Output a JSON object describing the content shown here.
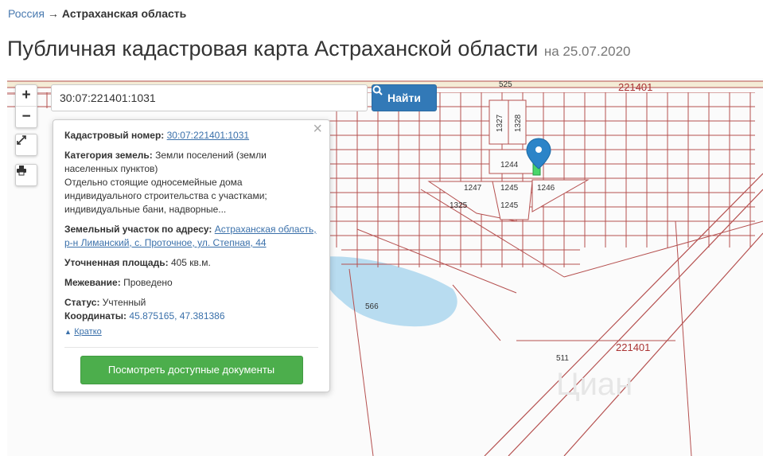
{
  "breadcrumbs": {
    "root": "Россия",
    "separator": "→",
    "current": "Астраханская область"
  },
  "page": {
    "title": "Публичная кадастровая карта Астраханской области",
    "date": "на 25.07.2020"
  },
  "search": {
    "value": "30:07:221401:1031",
    "button_label": "Найти"
  },
  "zoom": {
    "in": "+",
    "out": "−"
  },
  "popup": {
    "cad_label": "Кадастровый номер:",
    "cad_value": "30:07:221401:1031",
    "category_label": "Категория земель:",
    "category_value": "Земли поселений (земли населенных пунктов)",
    "usage_text": "Отдельно стоящие односемейные дома индивидуального строительства с участками; индивидуальные бани, надворные...",
    "address_label": "Земельный участок по адресу:",
    "address_value": "Астраханская область, р-н Лиманский, с. Проточное, ул. Степная, 44",
    "area_label": "Уточненная площадь:",
    "area_value": "405 кв.м.",
    "survey_label": "Межевание:",
    "survey_value": "Проведено",
    "status_label": "Статус:",
    "status_value": "Учтенный",
    "coords_label": "Координаты:",
    "coords_value": "45.875165, 47.381386",
    "short_label": "Кратко",
    "docs_button": "Посмотреть доступные документы"
  },
  "map_labels": {
    "road": "525",
    "quarter_top": "221401",
    "quarter_bottom": "221401",
    "p1327": "1327",
    "p1328": "1328",
    "p1244": "1244",
    "p1247": "1247",
    "p1245a": "1245",
    "p1246": "1246",
    "p1325": "1325",
    "p1245b": "1245",
    "p566": "566",
    "p511": "511"
  },
  "watermark": "Циан",
  "colors": {
    "parcel_line": "#b5504f",
    "water": "#b8dcf0",
    "pin": "#2b84c8",
    "highlight": "#4bd66a",
    "button_blue": "#3279b7",
    "button_green": "#4cae4c"
  }
}
